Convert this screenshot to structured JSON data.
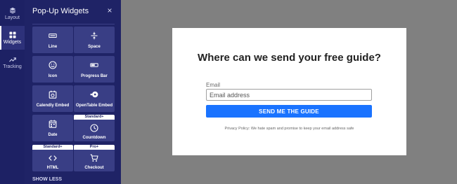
{
  "rail": {
    "items": [
      {
        "label": "Layout",
        "icon": "layers-icon"
      },
      {
        "label": "Widgets",
        "icon": "grid-icon",
        "active": true
      },
      {
        "label": "Tracking",
        "icon": "trending-up-icon"
      }
    ]
  },
  "panel": {
    "title": "Pop-Up Widgets",
    "close": "×",
    "show_less": "SHOW LESS",
    "widgets": [
      {
        "name": "Line",
        "icon": "line-icon"
      },
      {
        "name": "Space",
        "icon": "space-icon"
      },
      {
        "name": "Icon",
        "icon": "smiley-icon"
      },
      {
        "name": "Progress Bar",
        "icon": "progress-bar-icon"
      },
      {
        "name": "Calendly Embed",
        "icon": "calendly-icon"
      },
      {
        "name": "OpenTable Embed",
        "icon": "opentable-icon"
      },
      {
        "name": "Date",
        "icon": "calendar-icon"
      },
      {
        "name": "Countdown",
        "icon": "clock-icon",
        "badge": "Standard+"
      },
      {
        "name": "HTML",
        "icon": "code-icon",
        "badge": "Standard+"
      },
      {
        "name": "Checkout",
        "icon": "cart-icon",
        "badge": "Pro+"
      }
    ]
  },
  "modal": {
    "title": "Where can we send your free guide?",
    "email_label": "Email",
    "email_placeholder": "Email address",
    "button": "SEND ME THE GUIDE",
    "privacy": "Privacy Policy: We hate spam and promise to keep your email address safe"
  },
  "colors": {
    "rail_bg": "#1d2164",
    "panel_bg": "#1f2366",
    "tile_bg": "#393e85",
    "canvas_bg": "#808080",
    "button_bg": "#1a73ff"
  }
}
